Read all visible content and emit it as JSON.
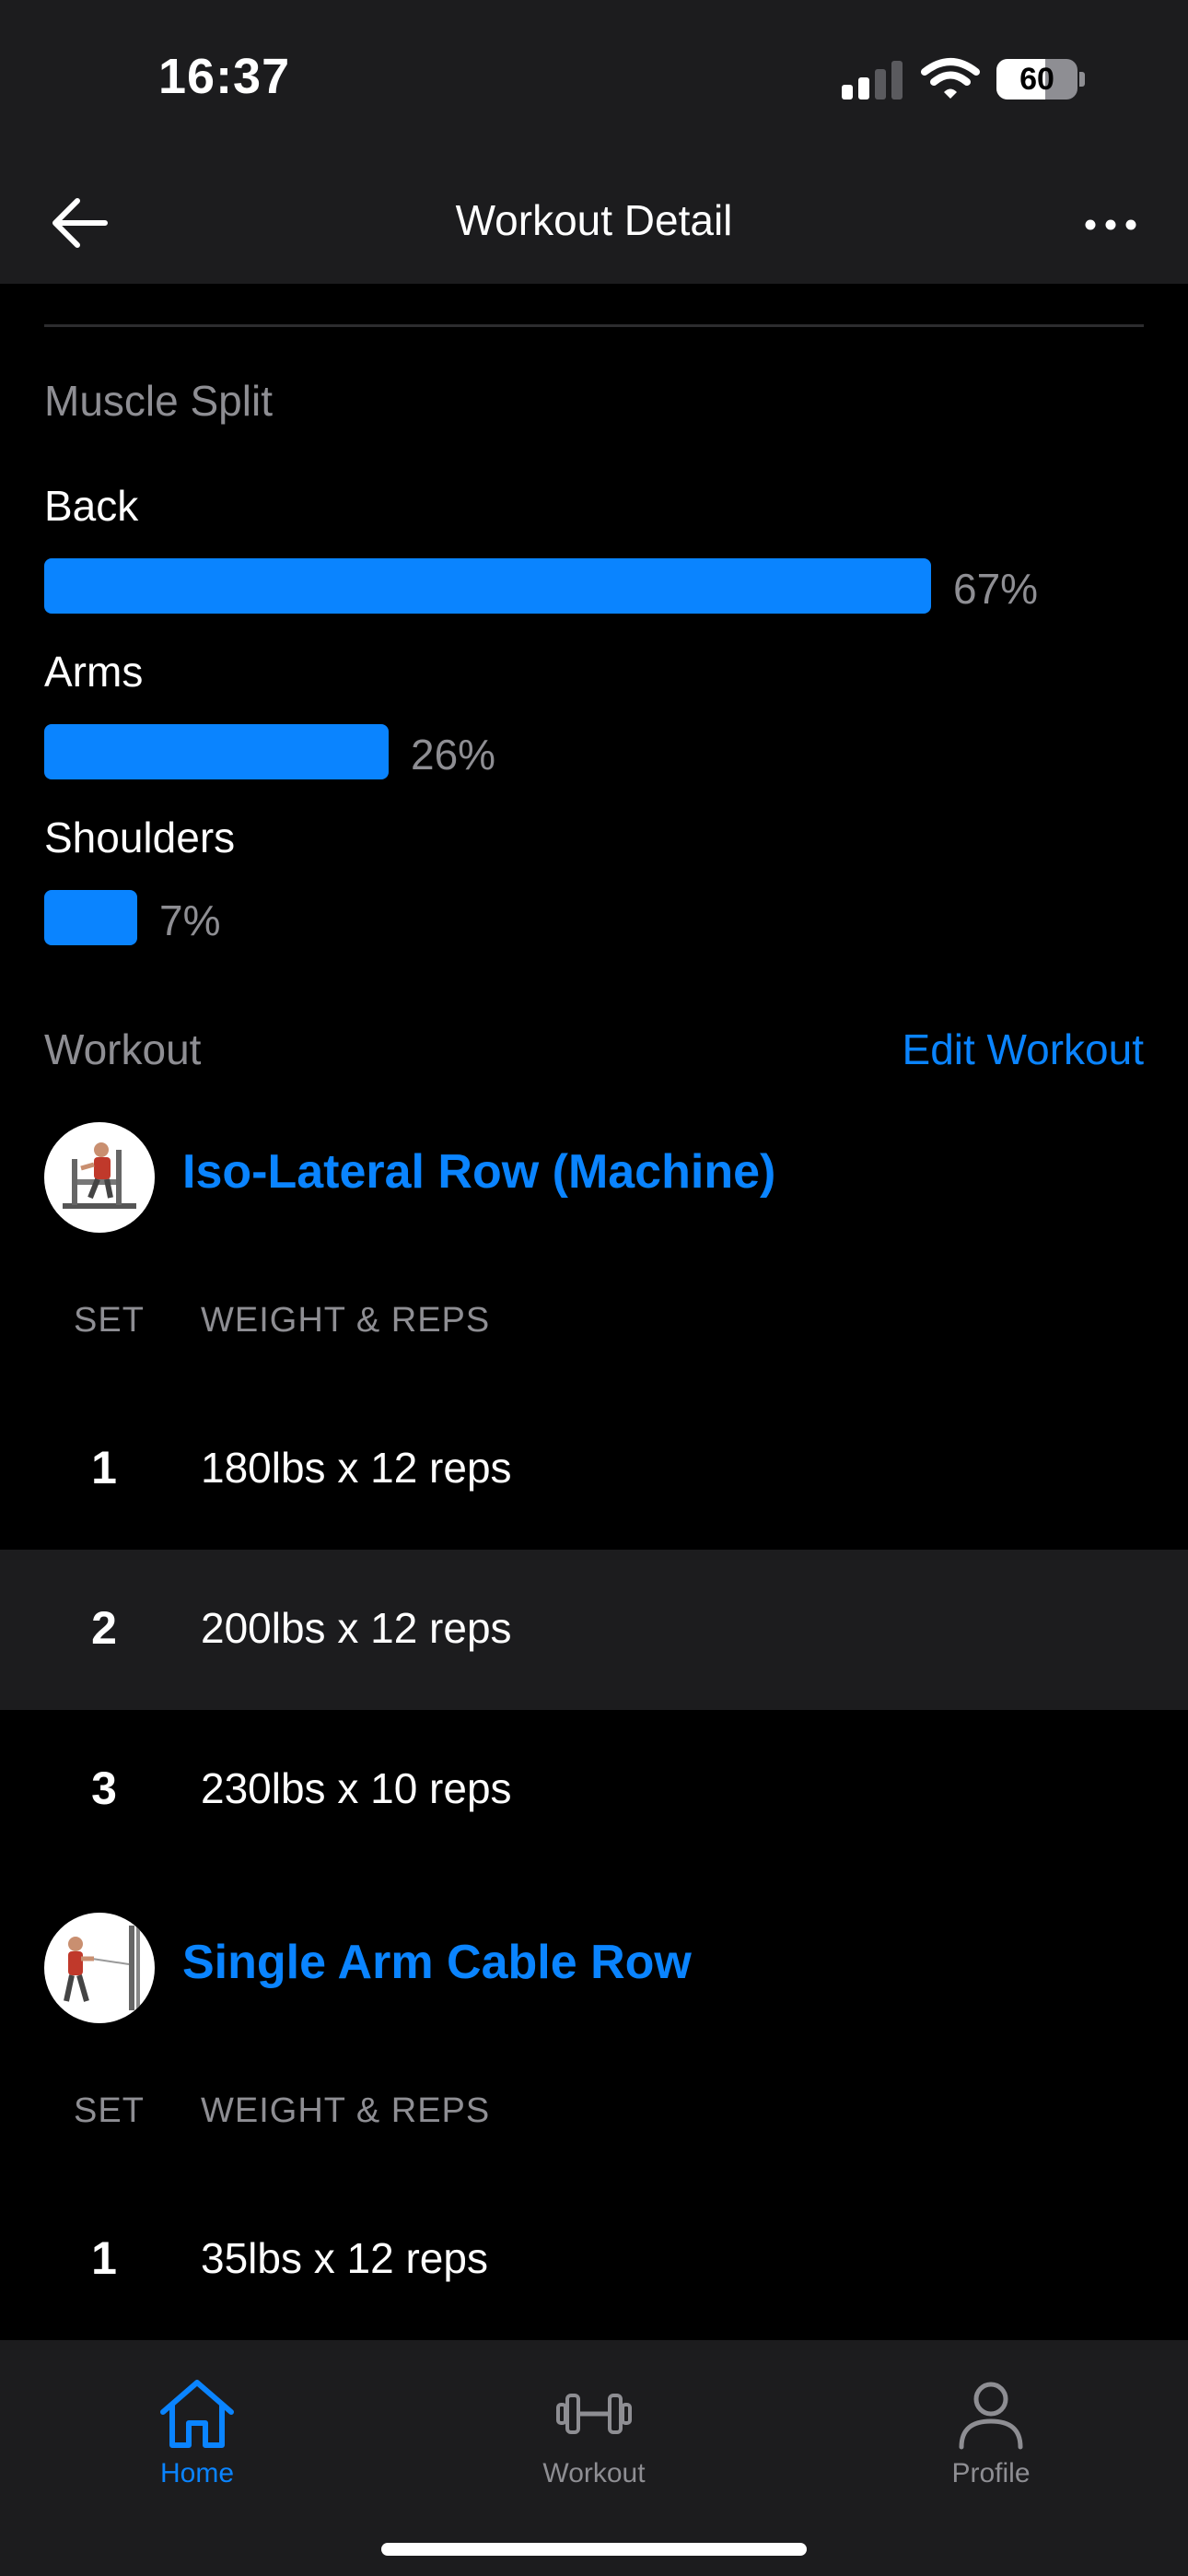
{
  "status_bar": {
    "time": "16:37",
    "battery": "60"
  },
  "nav": {
    "title": "Workout Detail"
  },
  "muscle_split": {
    "heading": "Muscle Split",
    "items": [
      {
        "label": "Back",
        "percent_text": "67%",
        "percent": 67
      },
      {
        "label": "Arms",
        "percent_text": "26%",
        "percent": 26
      },
      {
        "label": "Shoulders",
        "percent_text": "7%",
        "percent": 7
      }
    ]
  },
  "workout": {
    "heading": "Workout",
    "edit_label": "Edit Workout",
    "exercises": [
      {
        "name": "Iso-Lateral Row (Machine)",
        "col_set": "SET",
        "col_weight": "WEIGHT & REPS",
        "sets": [
          {
            "n": "1",
            "value": "180lbs x 12 reps"
          },
          {
            "n": "2",
            "value": "200lbs x 12 reps"
          },
          {
            "n": "3",
            "value": "230lbs x 10 reps"
          }
        ]
      },
      {
        "name": "Single Arm Cable Row",
        "col_set": "SET",
        "col_weight": "WEIGHT & REPS",
        "sets": [
          {
            "n": "1",
            "value": "35lbs x 12 reps"
          }
        ]
      }
    ]
  },
  "tabs": [
    {
      "label": "Home",
      "icon": "home-icon",
      "active": true
    },
    {
      "label": "Workout",
      "icon": "dumbbell-icon",
      "active": false
    },
    {
      "label": "Profile",
      "icon": "person-icon",
      "active": false
    }
  ],
  "colors": {
    "accent": "#0a84ff",
    "background": "#000000",
    "surface": "#1c1c1e",
    "muted": "#8e8e93"
  }
}
